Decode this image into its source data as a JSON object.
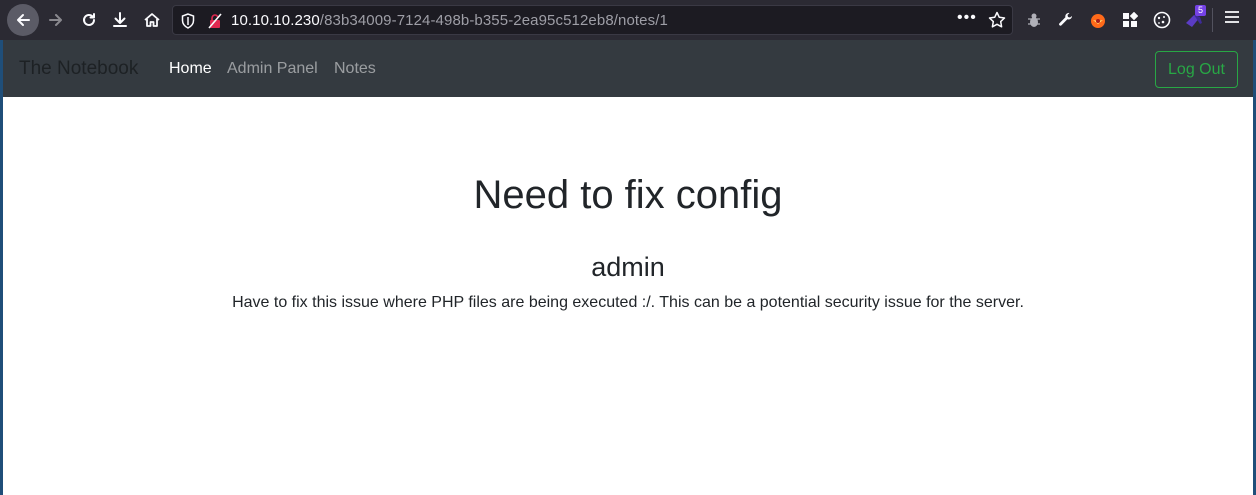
{
  "browser": {
    "url_host": "10.10.10.230",
    "url_path": "/83b34009-7124-498b-b355-2ea95c512eb8/notes/1",
    "extension_badge": "5",
    "icons": [
      "back-arrow-icon",
      "forward-arrow-icon",
      "reload-icon",
      "download-icon",
      "home-icon",
      "shield-icon",
      "insecure-lock-icon",
      "more-dots-icon",
      "bookmark-star-icon",
      "extension-icons",
      "hamburger-menu-icon"
    ]
  },
  "navbar": {
    "brand": "The Notebook",
    "links": [
      {
        "label": "Home",
        "active": true
      },
      {
        "label": "Admin Panel"
      },
      {
        "label": "Notes"
      }
    ],
    "logout_label": "Log Out"
  },
  "note": {
    "title": "Need to fix config",
    "author": "admin",
    "body": "Have to fix this issue where PHP files are being executed :/. This can be a potential security issue for the server."
  },
  "colors": {
    "navbar_bg": "#343a40",
    "logout_green": "#28a745",
    "browser_bg": "#2b2a33"
  }
}
